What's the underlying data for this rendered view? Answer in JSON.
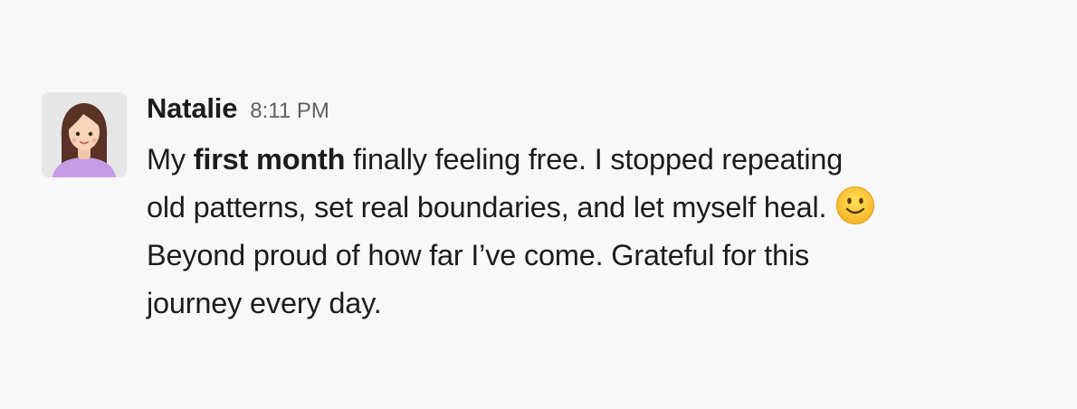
{
  "message": {
    "author": "Natalie",
    "time": "8:11 PM",
    "avatar_icon": "woman-avatar-icon",
    "emoji_icon": "slightly-smiling-face-icon",
    "text": {
      "line1_pre": "My ",
      "line1_bold": "first month",
      "line1_post": " finally feeling free. I stopped repeating",
      "line2": "old patterns, set real boundaries, and let myself heal.",
      "line3": "Beyond proud of how far I’ve come. Grateful for this",
      "line4": "journey every day."
    }
  }
}
